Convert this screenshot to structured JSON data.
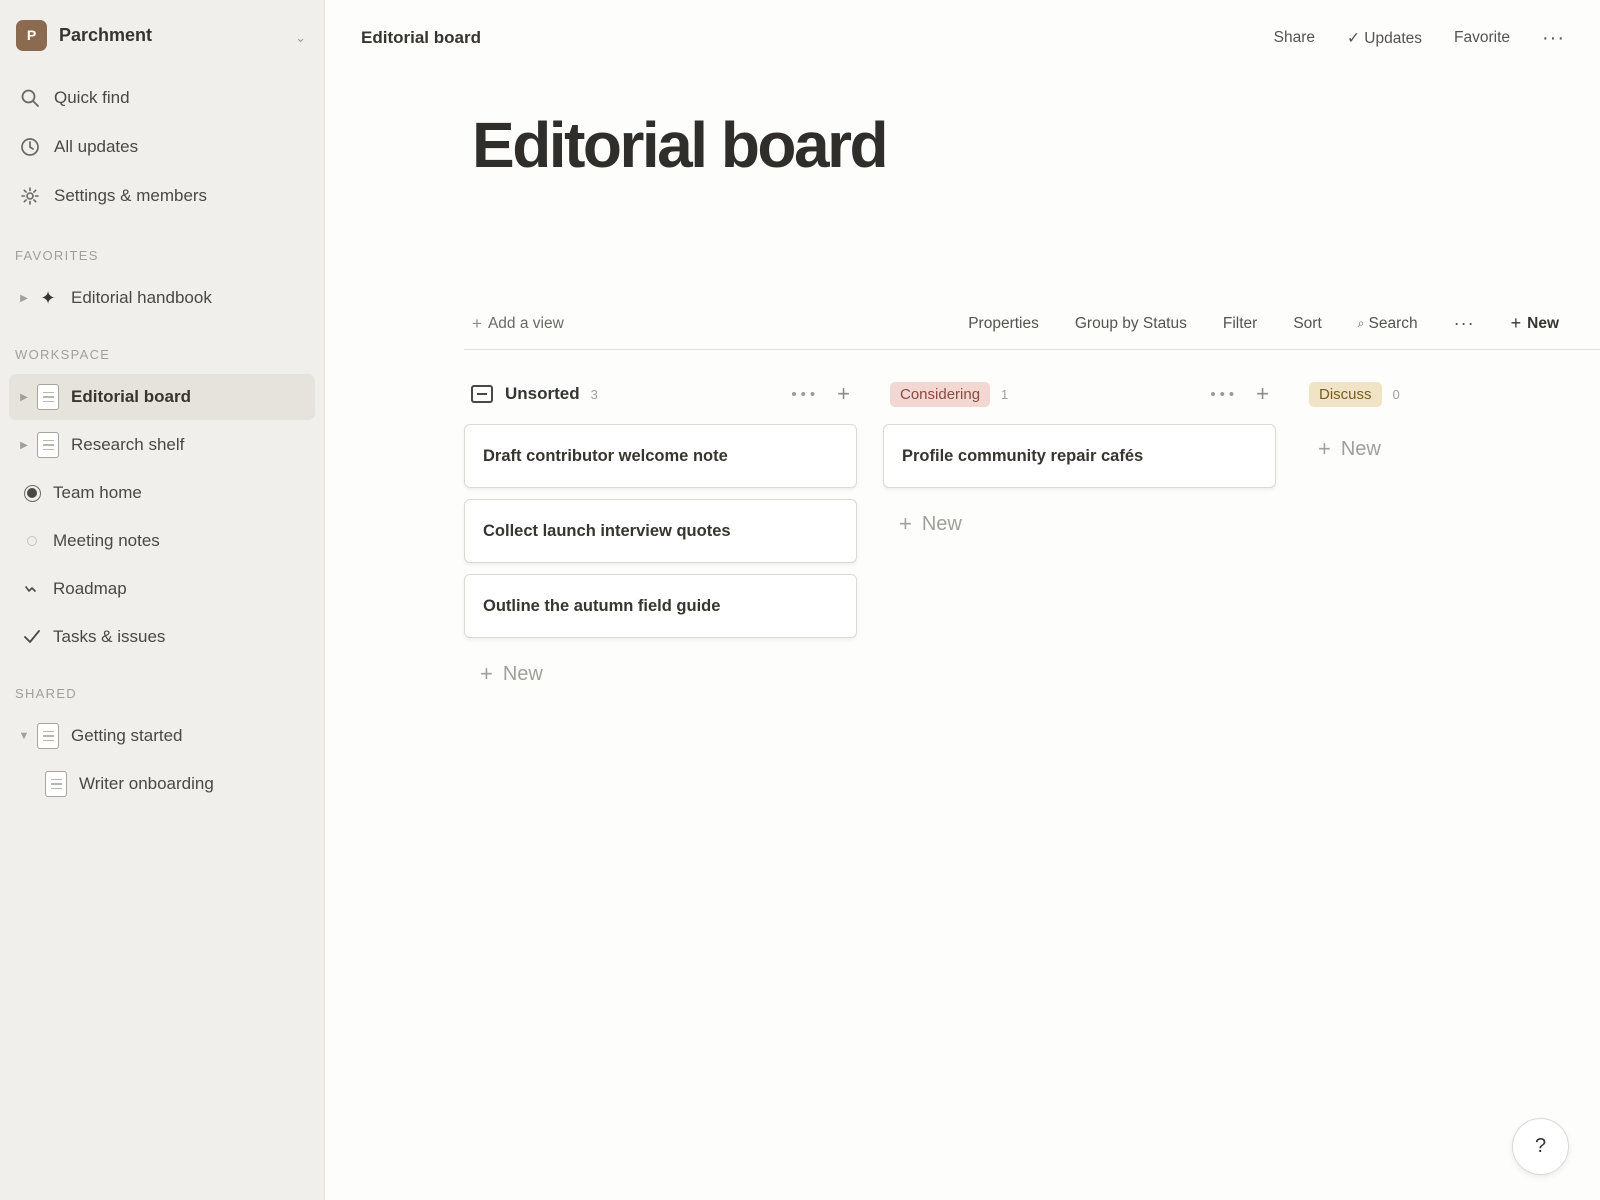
{
  "workspace": {
    "initial": "P",
    "name": "Parchment",
    "chevron": "⌄"
  },
  "sidebar": {
    "nav": [
      {
        "label": "Quick find",
        "icon": "search-icon"
      },
      {
        "label": "All updates",
        "icon": "clock-icon"
      },
      {
        "label": "Settings & members",
        "icon": "gear-icon"
      }
    ],
    "favorites_label": "FAVORITES",
    "favorites": [
      {
        "label": "Editorial handbook",
        "icon": "sparkle-icon"
      }
    ],
    "workspace_label": "WORKSPACE",
    "workspace_items": [
      {
        "label": "Editorial board",
        "icon": "page-icon",
        "active": true
      },
      {
        "label": "Research shelf",
        "icon": "page-icon"
      },
      {
        "label": "Team home",
        "icon": "radio-icon"
      },
      {
        "label": "Meeting notes",
        "icon": "circle-icon"
      },
      {
        "label": "Roadmap",
        "icon": "squiggle-icon"
      },
      {
        "label": "Tasks & issues",
        "icon": "check-icon"
      }
    ],
    "shared_label": "SHARED",
    "shared": [
      {
        "label": "Getting started",
        "icon": "page-icon",
        "expanded": true
      },
      {
        "label": "Writer onboarding",
        "icon": "page-icon"
      }
    ]
  },
  "topbar": {
    "breadcrumb": "Editorial board",
    "share": "Share",
    "updates": "✓ Updates",
    "favorite": "Favorite",
    "more": "···"
  },
  "page": {
    "title": "Editorial board"
  },
  "view_bar": {
    "add_view": "Add a view",
    "properties": "Properties",
    "group_by": "Group by Status",
    "filter": "Filter",
    "sort": "Sort",
    "search": "Search",
    "more": "···",
    "new": "New"
  },
  "board": {
    "columns": [
      {
        "title": "Unsorted",
        "count": "3",
        "cards": [
          "Draft contributor welcome note",
          "Collect launch interview quotes",
          "Outline the autumn field guide"
        ],
        "new_label": "New"
      },
      {
        "title": "Considering",
        "count": "1",
        "color": "#f2d7d3",
        "cards": [
          "Profile community repair cafés"
        ],
        "new_label": "New"
      },
      {
        "title": "Discuss",
        "count": "0",
        "color": "#f1e4c6",
        "cards": [],
        "new_label": "New"
      }
    ]
  },
  "help": "?"
}
